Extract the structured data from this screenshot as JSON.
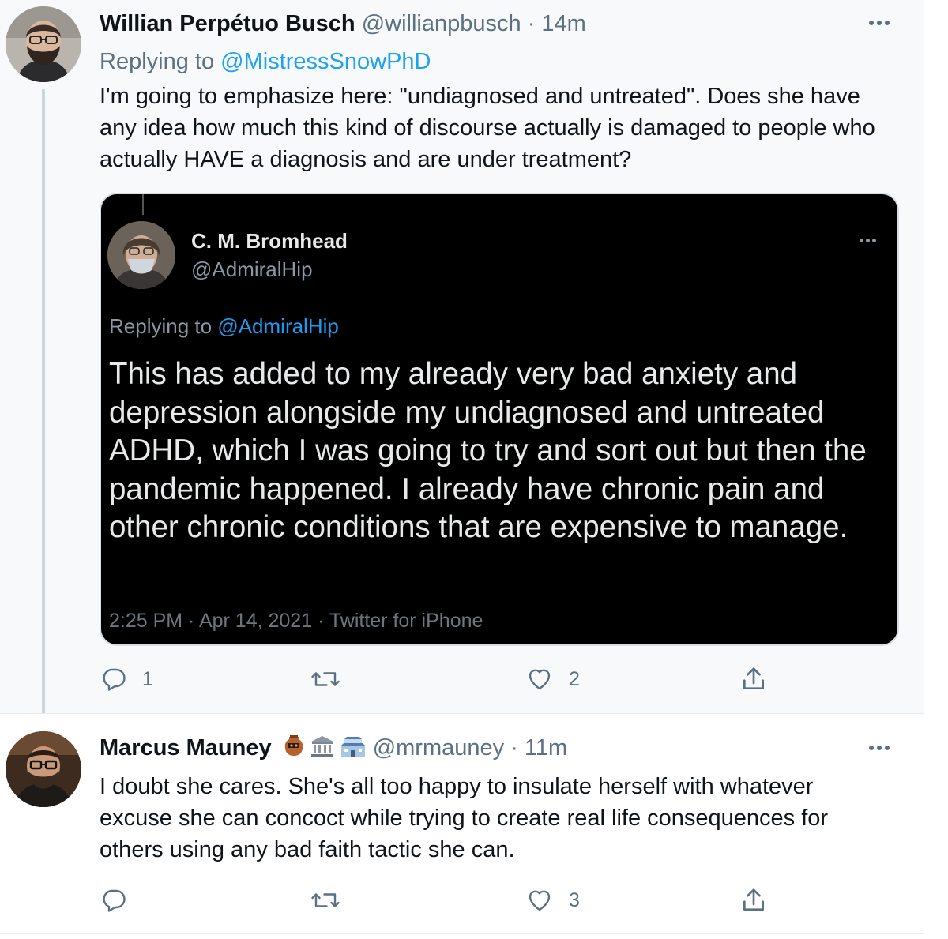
{
  "tweets": [
    {
      "author_name": "Willian Perpétuo Busch",
      "handle": "@willianpbusch",
      "separator": "·",
      "time": "14m",
      "replying_prefix": "Replying to",
      "replying_to": "@MistressSnowPhD",
      "text": "I'm going to emphasize here: \"undiagnosed and untreated\". Does she have any idea how much this kind of discourse actually is damaged to people who actually HAVE a diagnosis and are under treatment?",
      "avatar_icon": "bearded-man-glasses-avatar",
      "embedded_image": {
        "author_name": "C. M. Bromhead",
        "handle": "@AdmiralHip",
        "replying_prefix": "Replying to",
        "replying_to": "@AdmiralHip",
        "text": "This has added to my already very bad anxiety and depression alongside my undiagnosed and untreated ADHD, which I was going to try and sort out but then the pandemic happened. I already have chronic pain and other chronic conditions that are expensive to manage.",
        "meta": "2:25 PM · Apr 14, 2021 · Twitter for iPhone",
        "avatar_icon": "masked-person-avatar",
        "background": "#000000"
      },
      "actions": {
        "replies": "1",
        "retweets": "",
        "likes": "2"
      }
    },
    {
      "author_name": "Marcus Mauney",
      "name_emojis": [
        "amphora-icon",
        "classical-building-icon",
        "japanese-castle-icon"
      ],
      "handle": "@mrmauney",
      "separator": "·",
      "time": "11m",
      "text": "I doubt she cares. She's all too happy to insulate herself with whatever excuse she can concoct while trying to create real life consequences for others using any bad faith tactic she can.",
      "avatar_icon": "bearded-man-glasses-avatar",
      "actions": {
        "replies": "",
        "retweets": "",
        "likes": "3"
      }
    }
  ],
  "colors": {
    "accent": "#1da1f2",
    "secondary_text": "#5b7083",
    "primary_text": "#0f1419",
    "thread_line": "#ccd6dd",
    "highlight_background": "#f7f9fa"
  }
}
